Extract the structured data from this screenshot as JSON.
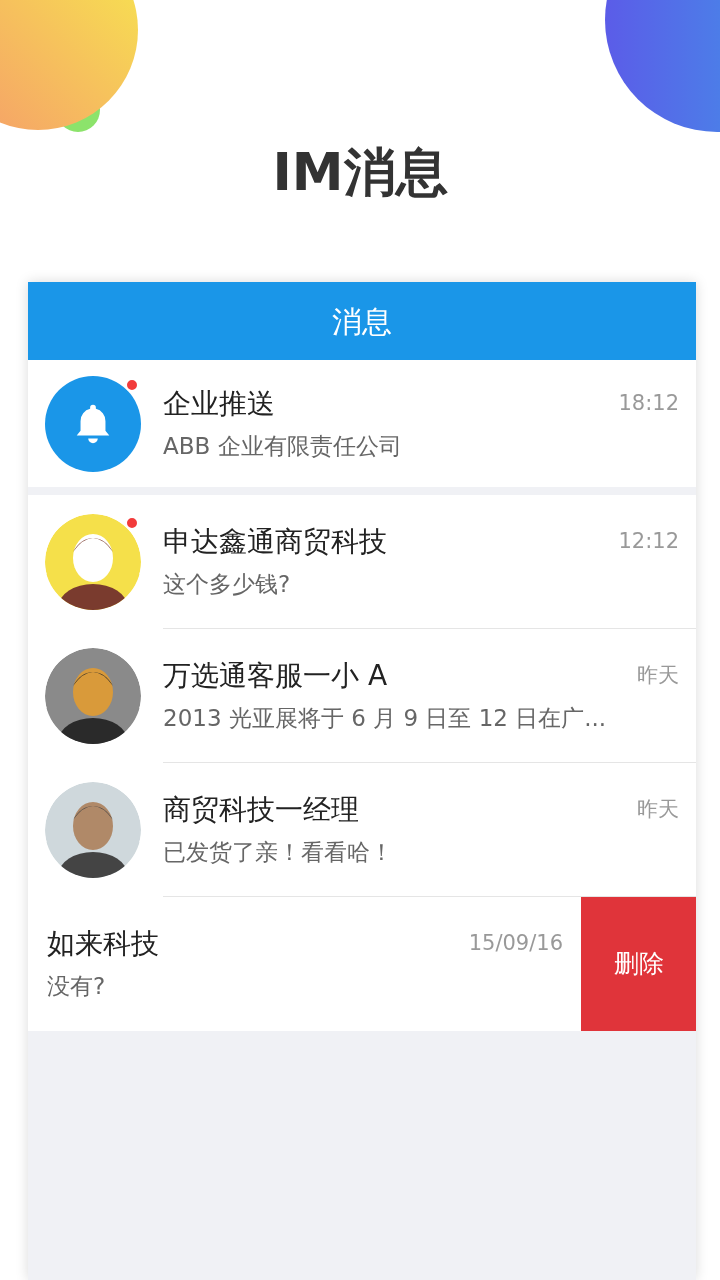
{
  "page_title": "IM消息",
  "header": {
    "title": "消息"
  },
  "conversations": [
    {
      "kind": "notification",
      "name": "企业推送",
      "time": "18:12",
      "preview": "ABB 企业有限责任公司",
      "unread": true
    },
    {
      "kind": "contact",
      "name": "申达鑫通商贸科技",
      "time": "12:12",
      "preview": "这个多少钱?",
      "unread": true
    },
    {
      "kind": "contact",
      "name": "万选通客服一小 A",
      "time": "昨天",
      "preview": "2013 光亚展将于 6 月 9 日至 12 日在广...",
      "unread": false
    },
    {
      "kind": "contact",
      "name": "商贸科技一经理",
      "time": "昨天",
      "preview": "已发货了亲！看看哈！",
      "unread": false
    },
    {
      "kind": "swiped",
      "name": "如来科技",
      "time": "15/09/16",
      "preview": "没有?",
      "action": "删除"
    }
  ]
}
